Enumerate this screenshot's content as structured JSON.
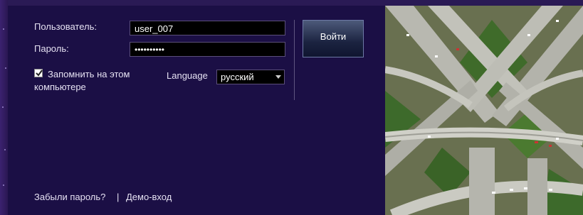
{
  "login": {
    "username_label": "Пользователь:",
    "username_value": "user_007",
    "password_label": "Пароль:",
    "password_value": "••••••••••",
    "remember_line1": "Запомнить на этом",
    "remember_line2": "компьютере",
    "remember_checked": true,
    "language_label": "Language",
    "language_value": "русский",
    "login_button": "Войти"
  },
  "footer": {
    "forgot_password": "Забыли пароль?",
    "separator": "|",
    "demo_login": "Демо-вход"
  },
  "colors": {
    "panel_bg": "#1b0f45",
    "text": "#e6e2f3",
    "field_bg": "#000000"
  },
  "image": {
    "subject": "aerial-highway-interchange-photo"
  }
}
